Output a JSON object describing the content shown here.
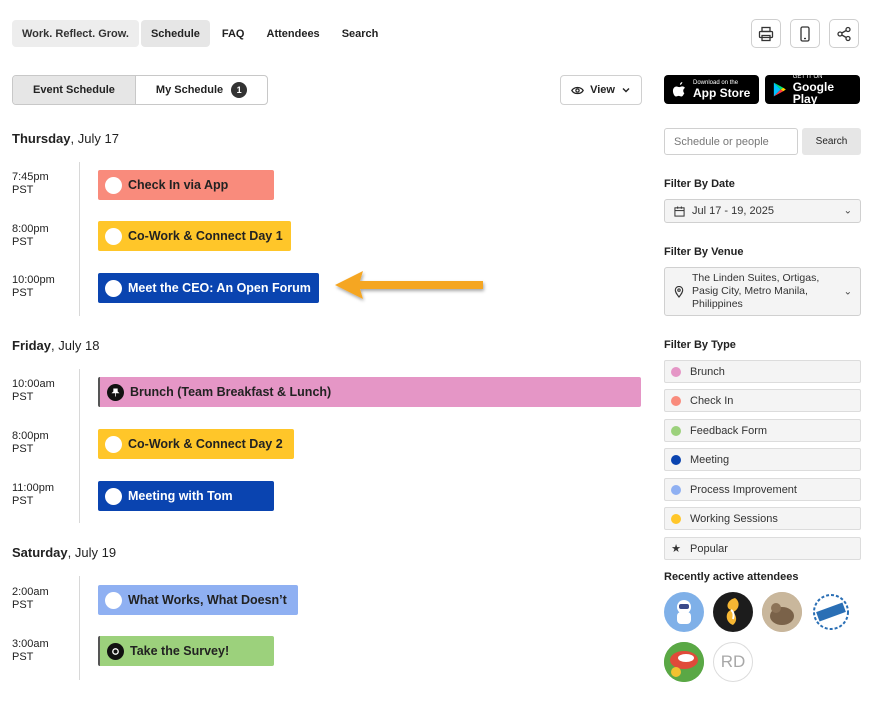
{
  "nav": {
    "brand": "Work. Reflect. Grow.",
    "tabs": [
      "Schedule",
      "FAQ",
      "Attendees",
      "Search"
    ]
  },
  "toggle": {
    "event_schedule": "Event Schedule",
    "my_schedule": "My Schedule",
    "my_count": "1"
  },
  "view_label": "View",
  "days": [
    {
      "weekday": "Thursday",
      "date": ", July 17",
      "events": [
        {
          "time": "7:45pm",
          "tz": "PST",
          "title": "Check In via App",
          "color": "#f98b7c"
        },
        {
          "time": "8:00pm",
          "tz": "PST",
          "title": "Co-Work & Connect Day 1",
          "color": "#ffc629"
        },
        {
          "time": "10:00pm",
          "tz": "PST",
          "title": "Meet the CEO: An Open Forum",
          "color": "#0a44b0"
        }
      ]
    },
    {
      "weekday": "Friday",
      "date": ", July 18",
      "events": [
        {
          "time": "10:00am",
          "tz": "PST",
          "title": "Brunch (Team Breakfast & Lunch)",
          "color": "#e596c6"
        },
        {
          "time": "8:00pm",
          "tz": "PST",
          "title": "Co-Work & Connect Day 2",
          "color": "#ffc629"
        },
        {
          "time": "11:00pm",
          "tz": "PST",
          "title": "Meeting with Tom",
          "color": "#0a44b0"
        }
      ]
    },
    {
      "weekday": "Saturday",
      "date": ", July 19",
      "events": [
        {
          "time": "2:00am",
          "tz": "PST",
          "title": "What Works, What Doesn’t",
          "color": "#8fb0f2"
        },
        {
          "time": "3:00am",
          "tz": "PST",
          "title": "Take the Survey!",
          "color": "#9cd17c"
        }
      ]
    }
  ],
  "sidebar": {
    "app_store": {
      "small": "Download on the",
      "big": "App Store"
    },
    "google_play": {
      "small": "GET IT ON",
      "big": "Google Play"
    },
    "search_placeholder": "Schedule or people",
    "search_button": "Search",
    "filter_date_label": "Filter By Date",
    "filter_date_value": "Jul 17 - 19, 2025",
    "filter_venue_label": "Filter By Venue",
    "filter_venue_value": "The Linden Suites, Ortigas, Pasig City, Metro Manila, Philippines",
    "filter_type_label": "Filter By Type",
    "types": [
      {
        "label": "Brunch",
        "color": "#e596c6"
      },
      {
        "label": "Check In",
        "color": "#f98b7c"
      },
      {
        "label": "Feedback Form",
        "color": "#9cd17c"
      },
      {
        "label": "Meeting",
        "color": "#0a44b0"
      },
      {
        "label": "Process Improvement",
        "color": "#8fb0f2"
      },
      {
        "label": "Working Sessions",
        "color": "#ffc629"
      },
      {
        "label": "Popular",
        "color": "#333333"
      }
    ],
    "attendees_label": "Recently active attendees",
    "attendee_initials": "RD"
  }
}
